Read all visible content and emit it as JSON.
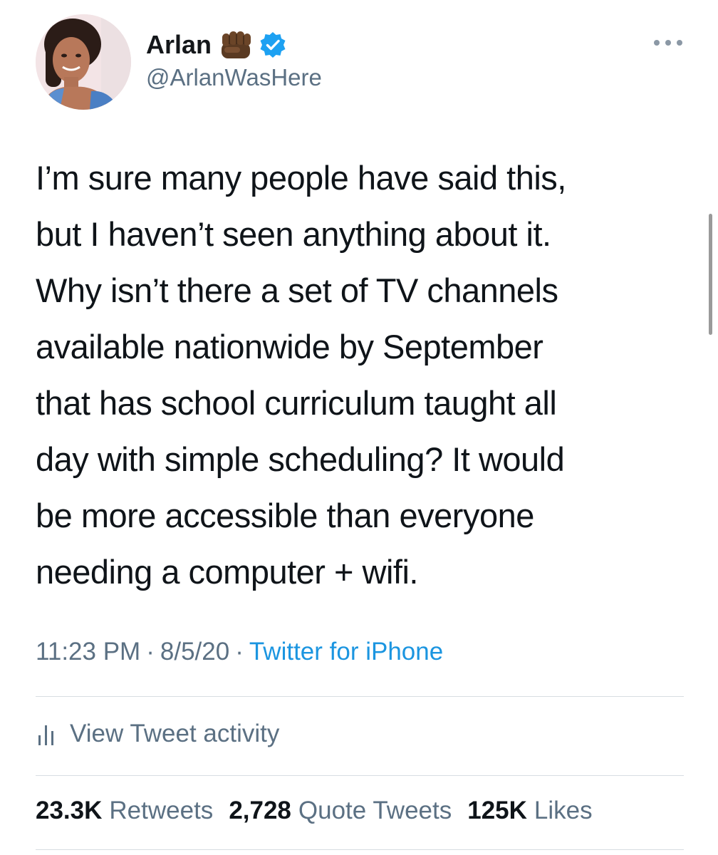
{
  "author": {
    "display_name": "Arlan",
    "handle": "@ArlanWasHere",
    "avatar_icon": "profile-photo",
    "emoji_icon": "raised-fist-icon",
    "verified_icon": "verified-badge-icon"
  },
  "tweet": {
    "text": "I’m sure many people have said this,\nbut I haven’t seen anything about it.\nWhy isn’t there a set of TV channels\navailable nationwide by September\nthat has school curriculum taught all\nday with simple scheduling? It would\nbe more accessible than everyone\nneeding a computer + wifi.",
    "time": "11:23 PM",
    "date": "8/5/20",
    "separator": "·",
    "source": "Twitter for iPhone"
  },
  "activity": {
    "label": "View Tweet activity",
    "icon": "bar-chart-icon"
  },
  "stats": {
    "retweets_count": "23.3K",
    "retweets_label": "Retweets",
    "quotes_count": "2,728",
    "quotes_label": "Quote Tweets",
    "likes_count": "125K",
    "likes_label": "Likes"
  },
  "colors": {
    "text_primary": "#0f1419",
    "text_secondary": "#5b7083",
    "link_blue": "#1b95e0",
    "verified_blue": "#1da1f2",
    "divider": "#d7dde2"
  }
}
